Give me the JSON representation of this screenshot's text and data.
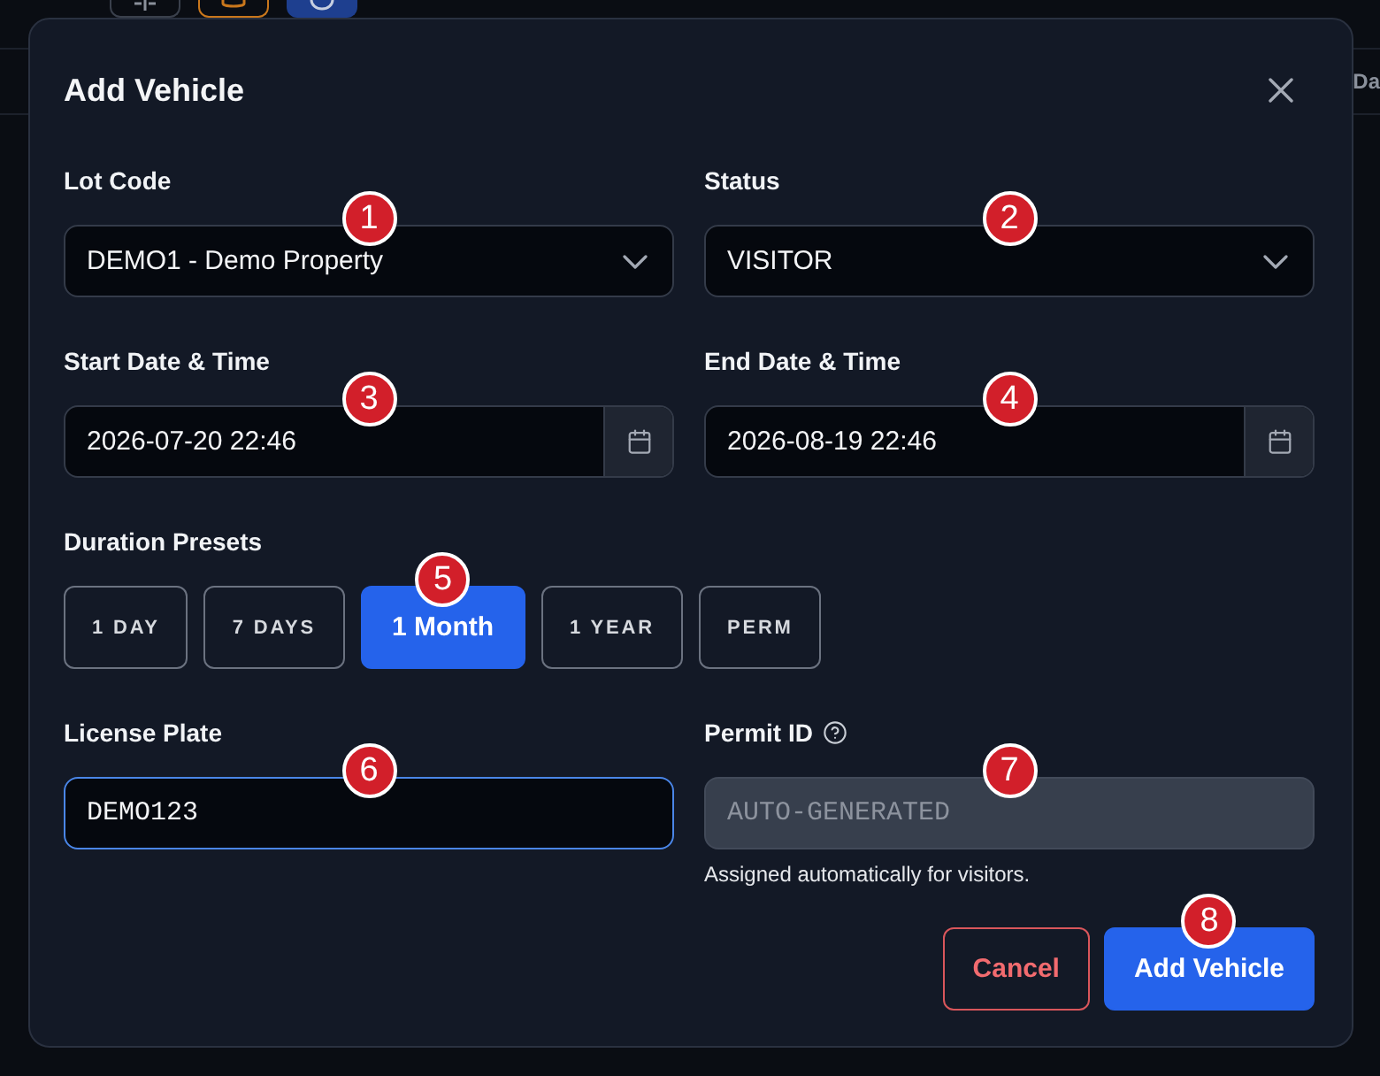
{
  "page": {
    "toolbar": [
      {
        "kind": "columns",
        "selected": false,
        "color": "#3a404c"
      },
      {
        "kind": "database",
        "selected": false,
        "color": "#c9771c"
      },
      {
        "kind": "circle",
        "selected": true,
        "color": "#1e3f8f"
      }
    ],
    "column_header": "Da"
  },
  "dialog": {
    "title": "Add Vehicle",
    "fields": [
      {
        "kind": "select",
        "label": "Lot Code",
        "value": "DEMO1 - Demo Property",
        "focused": false,
        "marker": "1"
      },
      {
        "kind": "select",
        "label": "Status",
        "value": "VISITOR",
        "focused": false,
        "marker": "2"
      },
      {
        "kind": "date",
        "label": "Start Date & Time",
        "value": "2026-07-20 22:46",
        "focused": false,
        "marker": "3"
      },
      {
        "kind": "date",
        "label": "End Date & Time",
        "value": "2026-08-19 22:46",
        "focused": false,
        "marker": "4"
      },
      {
        "kind": "presets",
        "label": "Duration Presets",
        "options": [
          {
            "label": "1 DAY",
            "selected": false
          },
          {
            "label": "7 DAYS",
            "selected": false
          },
          {
            "label": "1 Month",
            "selected": true,
            "marker": "5"
          },
          {
            "label": "1 YEAR",
            "selected": false
          },
          {
            "label": "PERM",
            "selected": false
          }
        ]
      },
      {
        "kind": "text",
        "label": "License Plate",
        "value": "DEMO123",
        "focused": true,
        "disabled": false,
        "marker": "6"
      },
      {
        "kind": "text",
        "label": "Permit ID",
        "placeholder": "AUTO-GENERATED",
        "focused": false,
        "disabled": true,
        "help": true,
        "hint": "Assigned automatically for visitors.",
        "marker": "7"
      }
    ],
    "actions": [
      {
        "kind": "secondary",
        "label": "Cancel"
      },
      {
        "kind": "primary",
        "label": "Add Vehicle",
        "marker": "8"
      }
    ]
  }
}
